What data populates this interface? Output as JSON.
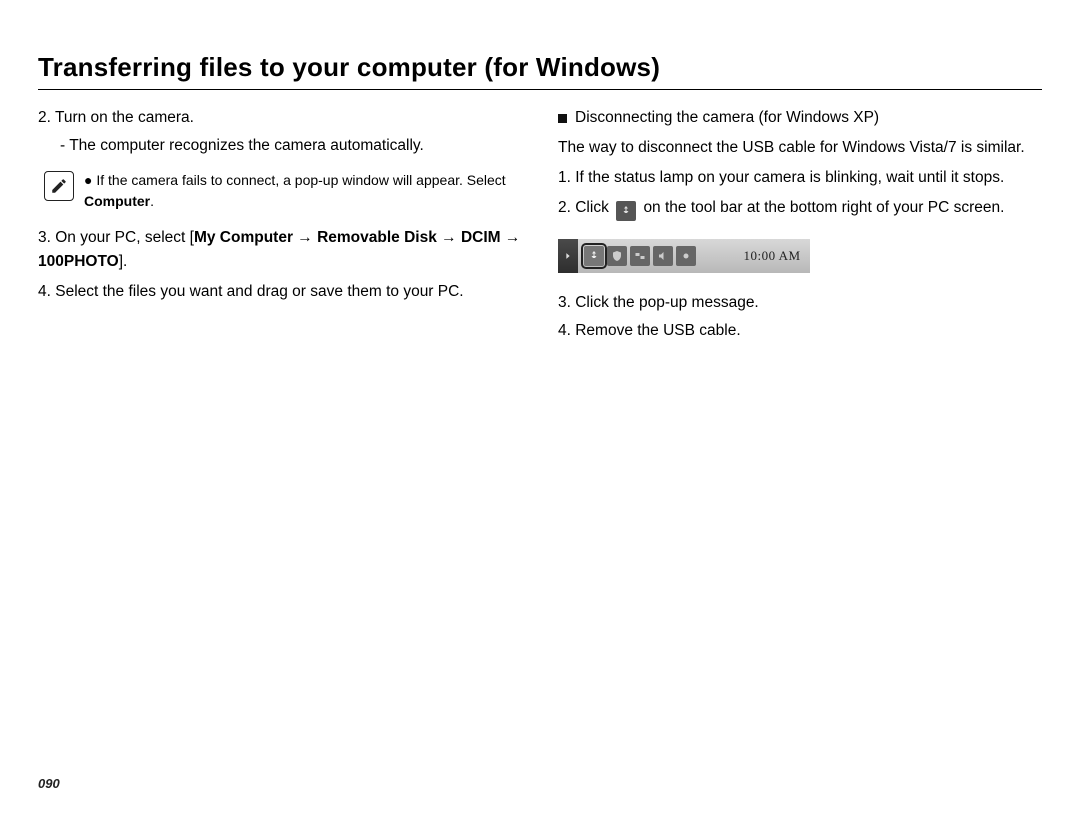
{
  "title": "Transferring files to your computer (for Windows)",
  "pageNumber": "090",
  "left": {
    "step2": "2. Turn on the camera.",
    "step2_sub": "- The computer recognizes the camera automatically.",
    "note_bullet": "● If the camera fails to connect, a pop-up window will appear. Select ",
    "note_bold": "Computer",
    "note_tail": ".",
    "step3_pre": "3. On your PC, select [",
    "step3_bold": "My Computer → Removable Disk → DCIM → 100PHOTO",
    "step3_post": "].",
    "step4": "4. Select the files you want and drag or save them to your PC."
  },
  "right": {
    "heading": "Disconnecting the camera (for Windows XP)",
    "intro": "The way to disconnect the USB cable for Windows Vista/7 is similar.",
    "r1": "1. If the status lamp on your camera is blinking, wait until it stops.",
    "r2_pre": "2. Click ",
    "r2_post": " on the tool bar at the bottom right of your PC screen.",
    "r3": "3. Click the pop-up message.",
    "r4": "4. Remove the USB cable.",
    "clock": "10:00 AM"
  }
}
